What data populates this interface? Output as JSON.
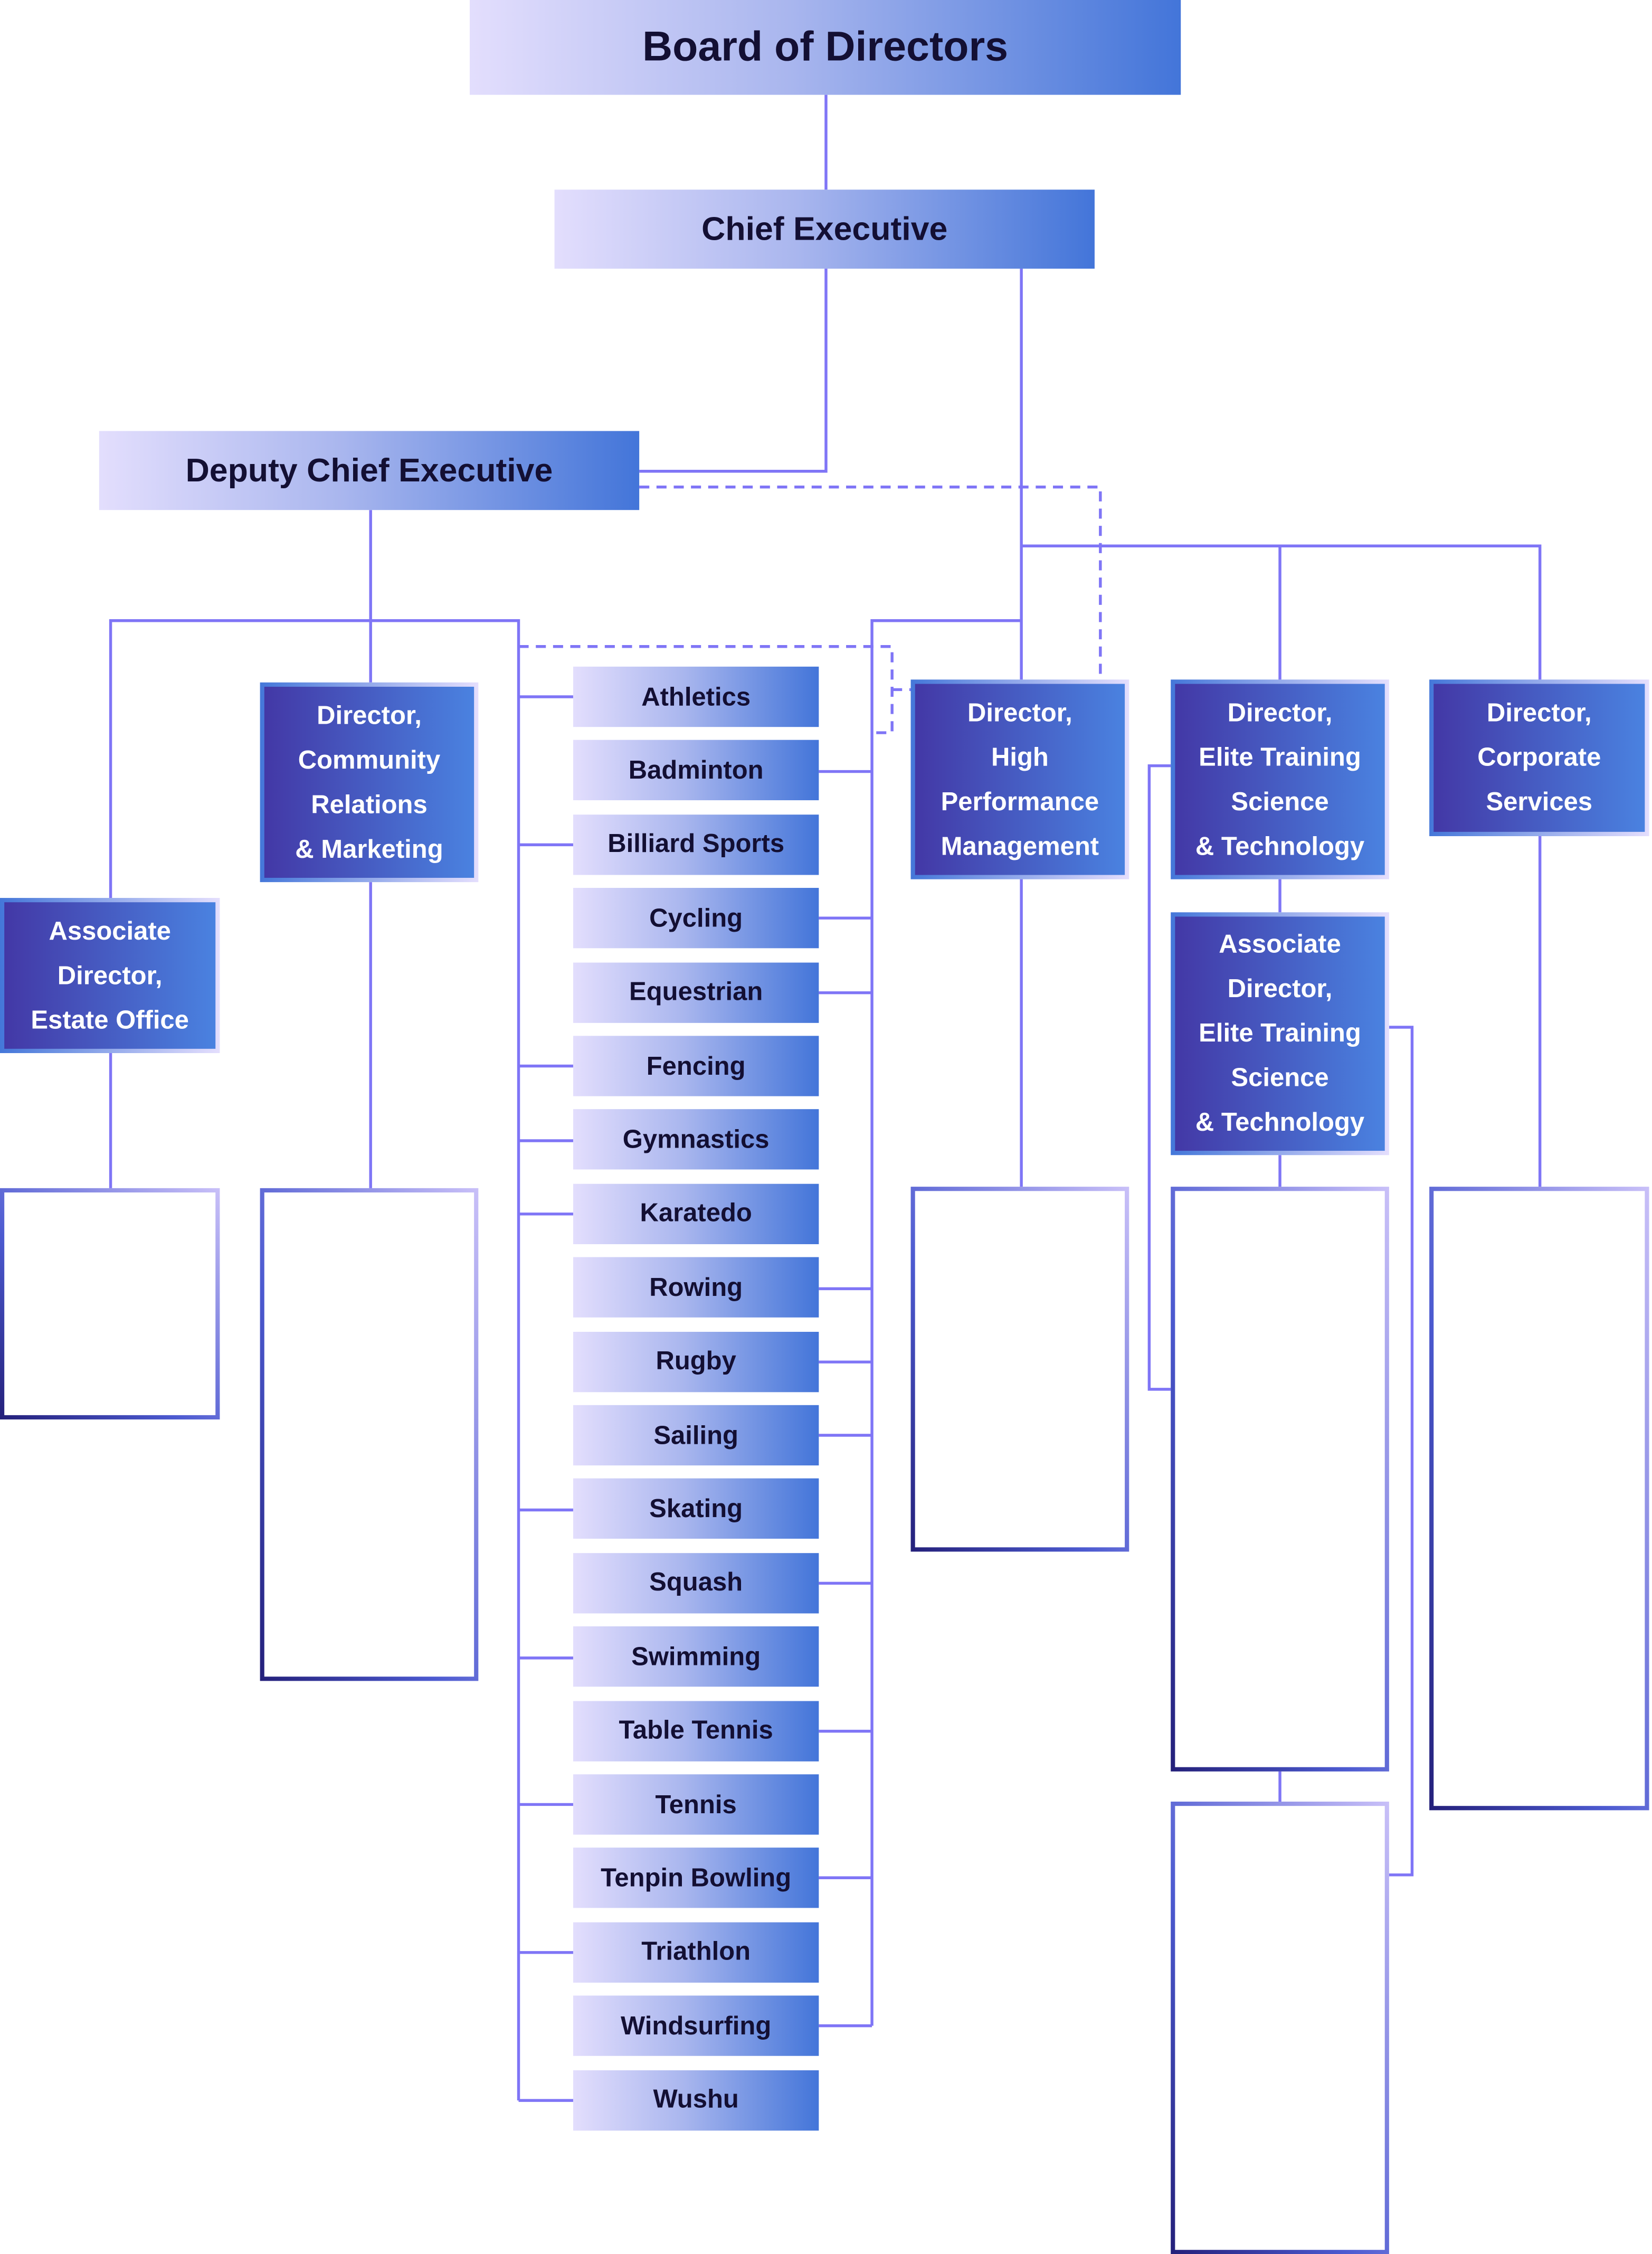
{
  "colors": {
    "connector": "#7f75f6",
    "light_box_start": "#e3defd",
    "light_box_end": "#4375d9",
    "director_start": "#4338a6",
    "director_end": "#4a82e0",
    "text_dark": "#130f33"
  },
  "top": {
    "board": "Board of Directors",
    "chief": "Chief Executive",
    "deputy": "Deputy Chief Executive"
  },
  "directors": {
    "community": "Director,\nCommunity\nRelations\n& Marketing",
    "hpm": "Director,\nHigh\nPerformance\nManagement",
    "elite": "Director,\nElite Training\nScience\n& Technology",
    "corporate": "Director,\nCorporate\nServices",
    "assoc_estate": "Associate\nDirector,\nEstate Office",
    "assoc_elite": "Associate\nDirector,\nElite Training\nScience\n& Technology"
  },
  "sports": [
    "Athletics",
    "Badminton",
    "Billiard Sports",
    "Cycling",
    "Equestrian",
    "Fencing",
    "Gymnastics",
    "Karatedo",
    "Rowing",
    "Rugby",
    "Sailing",
    "Skating",
    "Squash",
    "Swimming",
    "Table Tennis",
    "Tennis",
    "Tenpin Bowling",
    "Triathlon",
    "Windsurfing",
    "Wushu"
  ]
}
